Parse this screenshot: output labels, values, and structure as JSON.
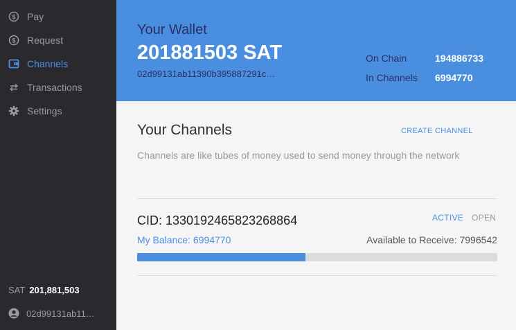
{
  "sidebar": {
    "items": [
      {
        "label": "Pay",
        "icon": "dollar-circle-icon",
        "active": false
      },
      {
        "label": "Request",
        "icon": "dollar-circle-icon",
        "active": false
      },
      {
        "label": "Channels",
        "icon": "wallet-icon",
        "active": true
      },
      {
        "label": "Transactions",
        "icon": "swap-arrows-icon",
        "active": false
      },
      {
        "label": "Settings",
        "icon": "gear-icon",
        "active": false
      }
    ],
    "footer": {
      "unit": "SAT",
      "amount": "201,881,503",
      "pubkey": "02d99131ab11…"
    }
  },
  "header": {
    "title": "Your Wallet",
    "amount": "201881503 SAT",
    "pubkey": "02d99131ab11390b395887291c…",
    "on_chain_label": "On Chain",
    "on_chain_value": "194886733",
    "in_channels_label": "In Channels",
    "in_channels_value": "6994770"
  },
  "channels": {
    "title": "Your Channels",
    "create_label": "CREATE CHANNEL",
    "description": "Channels are like tubes of money used to send money through the network",
    "list": [
      {
        "cid": "CID: 1330192465823268864",
        "status_active": "ACTIVE",
        "status_open": "OPEN",
        "my_balance": "My Balance: 6994770",
        "available_to_receive": "Available to Receive: 7996542",
        "balance_fraction": 0.4666
      }
    ]
  },
  "colors": {
    "accent": "#4a90e2",
    "header_bg": "#4a8fdf",
    "sidebar_bg": "#2a2a2e",
    "header_text_dark": "#2c2f66"
  }
}
